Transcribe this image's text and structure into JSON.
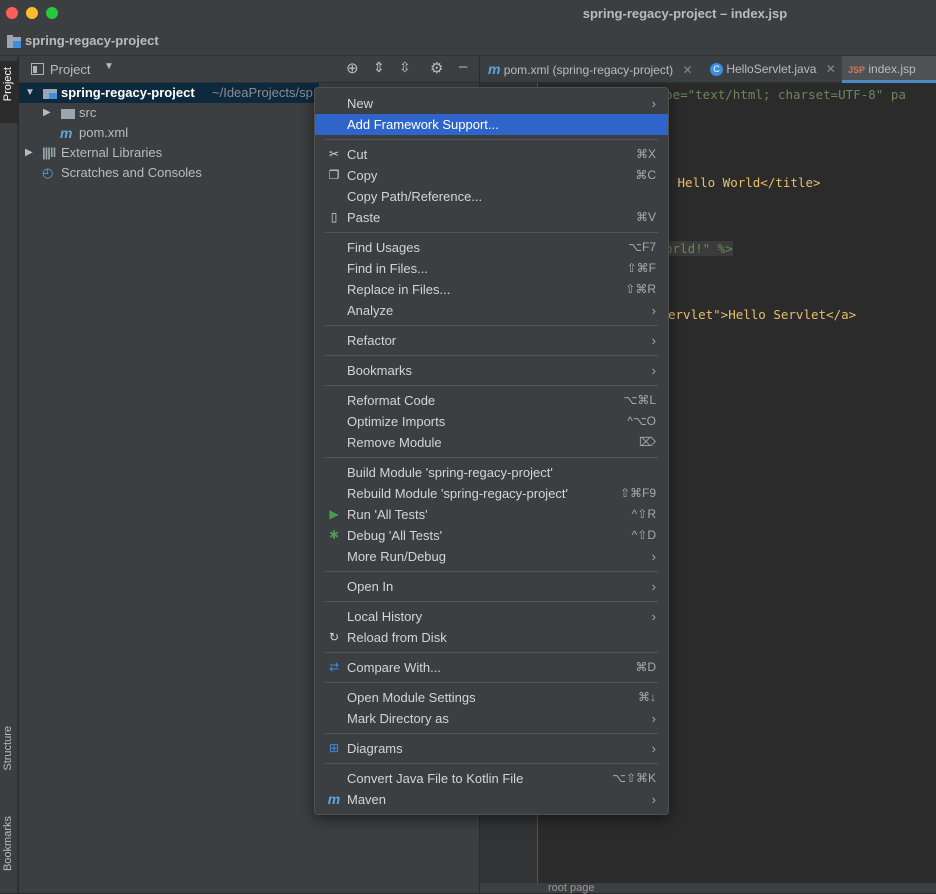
{
  "window": {
    "title": "spring-regacy-project – index.jsp"
  },
  "navbar": {
    "project": "spring-regacy-project"
  },
  "sidebar": {
    "project_tab": "Project",
    "structure_tab": "Structure",
    "bookmarks_tab": "Bookmarks"
  },
  "panel": {
    "title": "Project",
    "tree": [
      {
        "label": "spring-regacy-project",
        "path": "~/IdeaProjects/sp"
      },
      {
        "label": "src"
      },
      {
        "label": "pom.xml"
      },
      {
        "label": "External Libraries"
      },
      {
        "label": "Scratches and Consoles"
      }
    ]
  },
  "tabs": [
    {
      "label": "pom.xml (spring-regacy-project)"
    },
    {
      "label": "HelloServlet.java"
    },
    {
      "label": "index.jsp"
    }
  ],
  "code": {
    "line1": "Type=\"text/html; charset=UTF-8\" pa",
    "line2": " Hello World</title>",
    "line3": "orld!\" %>",
    "line4": "ervlet\">Hello Servlet</a>"
  },
  "breadcrumb": {
    "text": "root  page"
  },
  "menu": {
    "items": [
      {
        "label": "New",
        "shortcut": "",
        "submenu": true
      },
      {
        "label": "Add Framework Support...",
        "shortcut": ""
      },
      {
        "label": "Cut",
        "shortcut": "⌘X",
        "icon": "scissors-icon"
      },
      {
        "label": "Copy",
        "shortcut": "⌘C",
        "icon": "copy-icon"
      },
      {
        "label": "Copy Path/Reference...",
        "shortcut": ""
      },
      {
        "label": "Paste",
        "shortcut": "⌘V",
        "icon": "clipboard-icon"
      },
      {
        "label": "Find Usages",
        "shortcut": "⌥F7"
      },
      {
        "label": "Find in Files...",
        "shortcut": "⇧⌘F"
      },
      {
        "label": "Replace in Files...",
        "shortcut": "⇧⌘R"
      },
      {
        "label": "Analyze",
        "submenu": true
      },
      {
        "label": "Refactor",
        "submenu": true
      },
      {
        "label": "Bookmarks",
        "submenu": true
      },
      {
        "label": "Reformat Code",
        "shortcut": "⌥⌘L"
      },
      {
        "label": "Optimize Imports",
        "shortcut": "^⌥O"
      },
      {
        "label": "Remove Module",
        "shortcut": "⌦"
      },
      {
        "label": "Build Module 'spring-regacy-project'",
        "shortcut": ""
      },
      {
        "label": "Rebuild Module 'spring-regacy-project'",
        "shortcut": "⇧⌘F9"
      },
      {
        "label": "Run 'All Tests'",
        "shortcut": "^⇧R",
        "icon": "run-icon"
      },
      {
        "label": "Debug 'All Tests'",
        "shortcut": "^⇧D",
        "icon": "debug-icon"
      },
      {
        "label": "More Run/Debug",
        "submenu": true
      },
      {
        "label": "Open In",
        "submenu": true
      },
      {
        "label": "Local History",
        "submenu": true
      },
      {
        "label": "Reload from Disk",
        "icon": "reload-icon"
      },
      {
        "label": "Compare With...",
        "shortcut": "⌘D",
        "icon": "compare-icon"
      },
      {
        "label": "Open Module Settings",
        "shortcut": "⌘↓"
      },
      {
        "label": "Mark Directory as",
        "submenu": true
      },
      {
        "label": "Diagrams",
        "submenu": true,
        "icon": "diagram-icon"
      },
      {
        "label": "Convert Java File to Kotlin File",
        "shortcut": "⌥⇧⌘K"
      },
      {
        "label": "Maven",
        "submenu": true,
        "icon": "maven-icon"
      }
    ]
  },
  "colors": {
    "highlight": "#2f65ca",
    "menu_bg": "#3c3f41",
    "editor_bg": "#2b2b2b"
  }
}
